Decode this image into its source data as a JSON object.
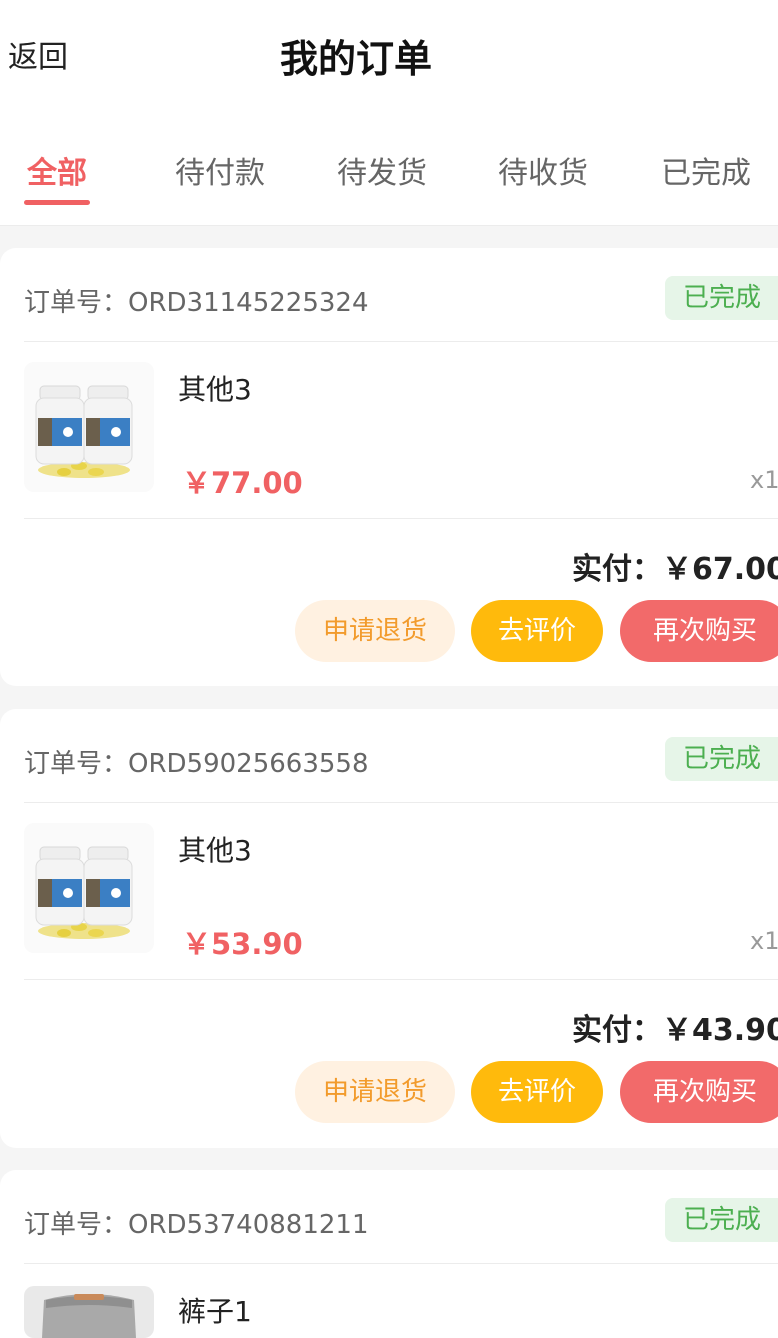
{
  "header": {
    "back_label": "返回",
    "title": "我的订单"
  },
  "tabs": [
    {
      "label": "全部",
      "active": true
    },
    {
      "label": "待付款",
      "active": false
    },
    {
      "label": "待发货",
      "active": false
    },
    {
      "label": "待收货",
      "active": false
    },
    {
      "label": "已完成",
      "active": false
    }
  ],
  "orders": [
    {
      "order_no": "订单号：ORD31145225324",
      "status": "已完成",
      "product": {
        "name": "其他3",
        "price": "￥77.00",
        "qty": "x1",
        "image": "supplement-bottles"
      },
      "paid": "实付：￥67.00",
      "buttons": {
        "refund": "申请退货",
        "review": "去评价",
        "rebuy": "再次购买"
      }
    },
    {
      "order_no": "订单号：ORD59025663558",
      "status": "已完成",
      "product": {
        "name": "其他3",
        "price": "￥53.90",
        "qty": "x1",
        "image": "supplement-bottles"
      },
      "paid": "实付：￥43.90",
      "buttons": {
        "refund": "申请退货",
        "review": "去评价",
        "rebuy": "再次购买"
      }
    },
    {
      "order_no": "订单号：ORD53740881211",
      "status": "已完成",
      "product": {
        "name": "裤子1",
        "image": "grey-pants"
      }
    }
  ],
  "colors": {
    "accent": "#f06163",
    "status_green": "#4caf50",
    "review_yellow": "#ffba0c",
    "refund_orange": "#f29b2c"
  }
}
